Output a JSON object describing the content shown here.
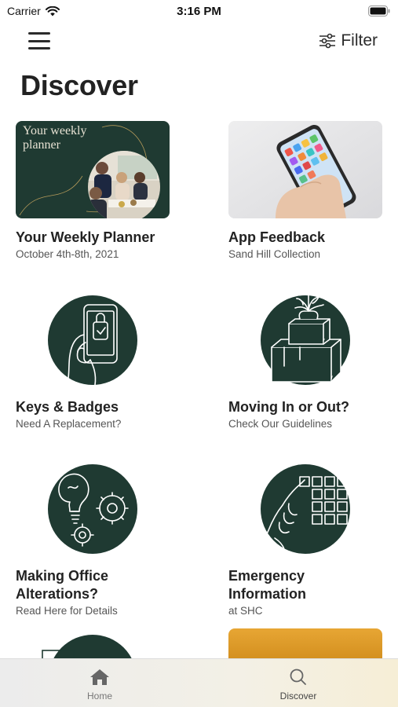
{
  "status_bar": {
    "carrier": "Carrier",
    "time": "3:16 PM"
  },
  "header": {
    "filter_label": "Filter"
  },
  "page": {
    "title": "Discover"
  },
  "cards": [
    {
      "title": "Your Weekly Planner",
      "subtitle": "October 4th-8th, 2021",
      "image_caption": "Your weekly planner"
    },
    {
      "title": "App Feedback",
      "subtitle": "Sand Hill Collection"
    },
    {
      "title": "Keys & Badges",
      "subtitle": "Need A Replacement?"
    },
    {
      "title": "Moving In or Out?",
      "subtitle": "Check Our Guidelines"
    },
    {
      "title": "Making Office Alterations?",
      "subtitle": "Read Here for Details"
    },
    {
      "title": "Emergency Information",
      "subtitle": "at SHC"
    }
  ],
  "tab_bar": {
    "tabs": [
      {
        "label": "Home"
      },
      {
        "label": "Discover"
      }
    ],
    "active": "Discover"
  },
  "colors": {
    "brand_green": "#1f3a32",
    "gold": "#e0a12c"
  }
}
